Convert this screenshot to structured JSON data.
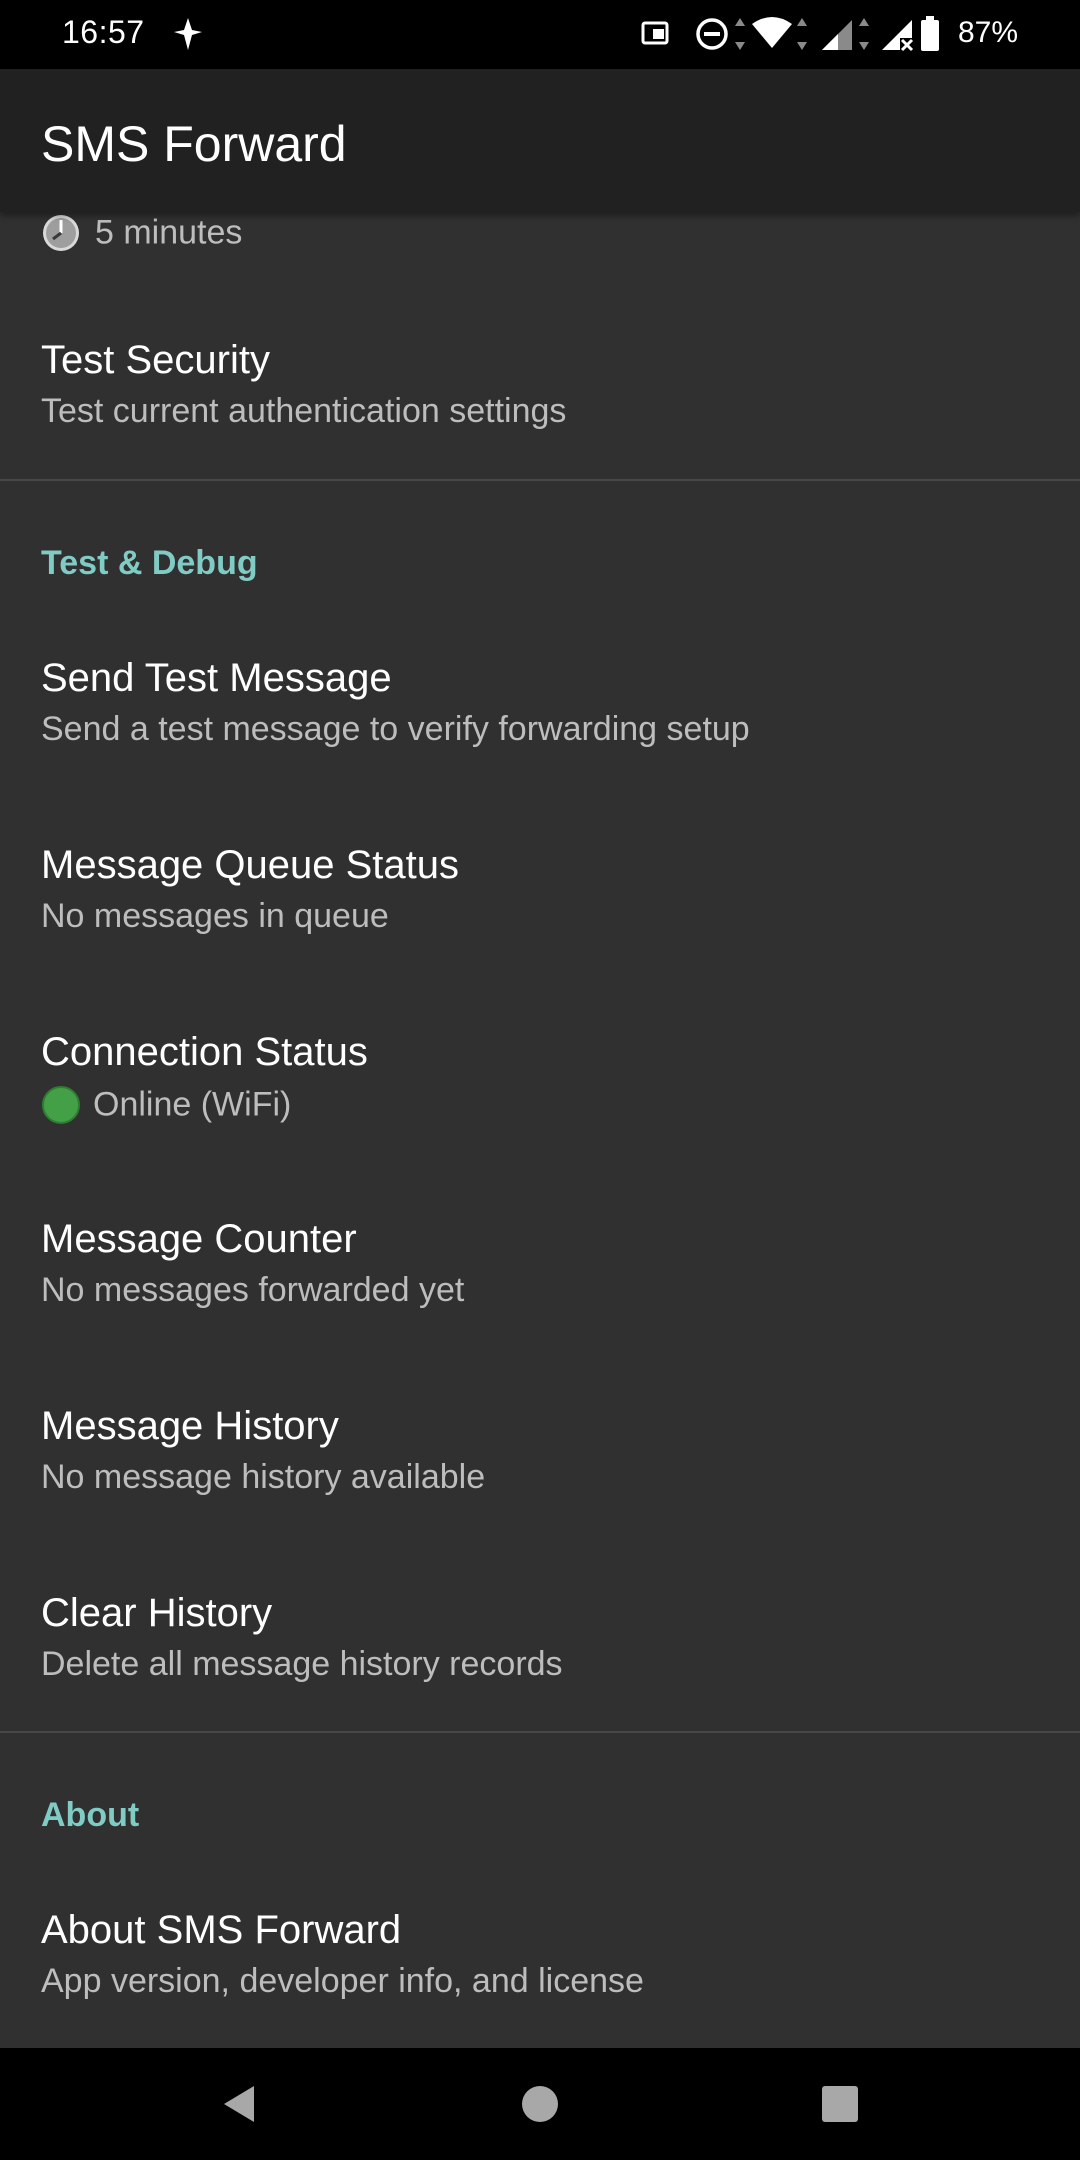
{
  "status_bar": {
    "time": "16:57",
    "battery_percent": "87%",
    "icons": [
      "navigation-icon",
      "cast-icon",
      "do-not-disturb-icon",
      "wifi-icon",
      "signal-icon",
      "signal-no-service-icon",
      "battery-icon"
    ]
  },
  "app_bar": {
    "title": "SMS Forward"
  },
  "partial_item": {
    "icon": "clock-icon",
    "summary": "5 minutes"
  },
  "security_section": {
    "test_security": {
      "title": "Test Security",
      "summary": "Test current authentication settings"
    }
  },
  "test_debug_section": {
    "header": "Test & Debug",
    "items": [
      {
        "title": "Send Test Message",
        "summary": "Send a test message to verify forwarding setup"
      },
      {
        "title": "Message Queue Status",
        "summary": "No messages in queue"
      },
      {
        "title": "Connection Status",
        "summary": "Online (WiFi)",
        "status_icon": "green-dot-icon"
      },
      {
        "title": "Message Counter",
        "summary": "No messages forwarded yet"
      },
      {
        "title": "Message History",
        "summary": "No message history available"
      },
      {
        "title": "Clear History",
        "summary": "Delete all message history records"
      }
    ]
  },
  "about_section": {
    "header": "About",
    "items": [
      {
        "title": "About SMS Forward",
        "summary": "App version, developer info, and license"
      }
    ]
  },
  "nav_bar": {
    "buttons": [
      "back-icon",
      "home-icon",
      "recents-icon"
    ]
  },
  "colors": {
    "background": "#303030",
    "app_bar": "#212121",
    "accent": "#80cbc4",
    "status_online": "#2e7d32"
  }
}
